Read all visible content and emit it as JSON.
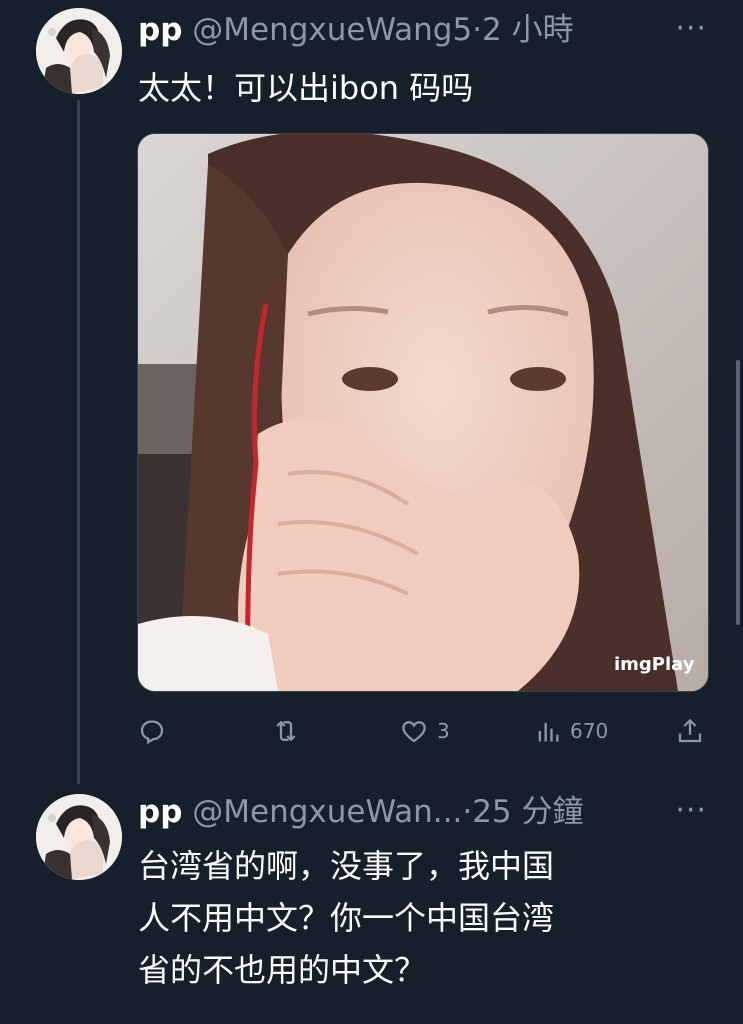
{
  "tweet1": {
    "display_name": "pp",
    "handle": "@MengxueWang5",
    "separator": "·",
    "time": "2 小時",
    "more_label": "···",
    "text": "太太！可以出ibon 码吗",
    "media_watermark": "imgPlay",
    "actions": {
      "reply_count": "",
      "retweet_count": "",
      "like_count": "3",
      "views_count": "670"
    }
  },
  "tweet2": {
    "display_name": "pp",
    "handle": "@MengxueWan...",
    "separator": "·",
    "time": "25 分鐘",
    "more_label": "···",
    "text_lines": [
      "台湾省的啊，没事了，我中国",
      "人不用中文？你一个中国台湾",
      "省的不也用的中文？"
    ]
  },
  "colors": {
    "background": "#15202b",
    "text_primary": "#ffffff",
    "text_secondary": "#8b98a5",
    "divider": "#38444d"
  },
  "icons": [
    "reply-icon",
    "retweet-icon",
    "like-icon",
    "views-icon",
    "share-icon",
    "more-icon"
  ]
}
